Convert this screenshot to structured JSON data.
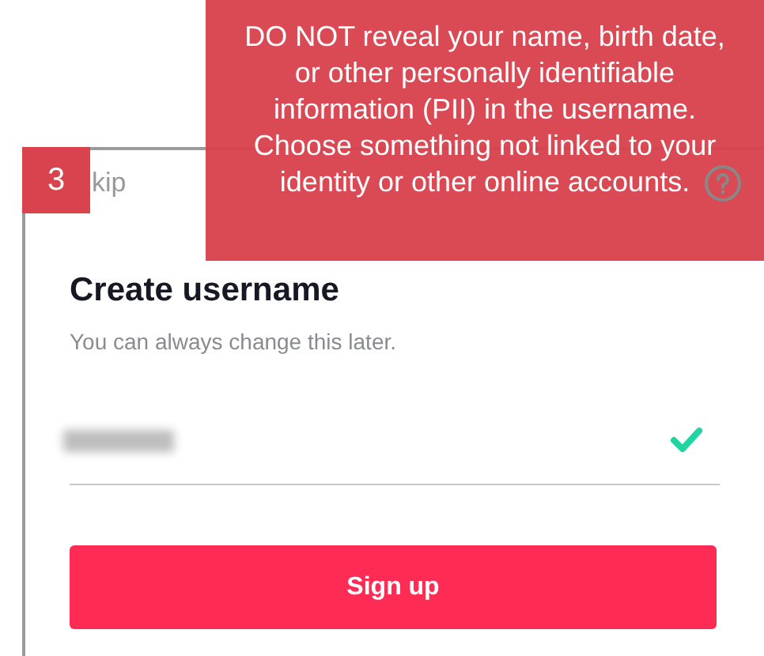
{
  "screen": {
    "header": {
      "skip": "kip"
    },
    "heading": "Create username",
    "subtitle": "You can always change this later.",
    "username_field": {
      "valid": true
    },
    "button": "Sign up"
  },
  "annotation": {
    "step": "3",
    "callout": "DO NOT reveal your name, birth date, or other personally identifiable information (PII) in the username. Choose something not linked to your identity or other online accounts."
  }
}
